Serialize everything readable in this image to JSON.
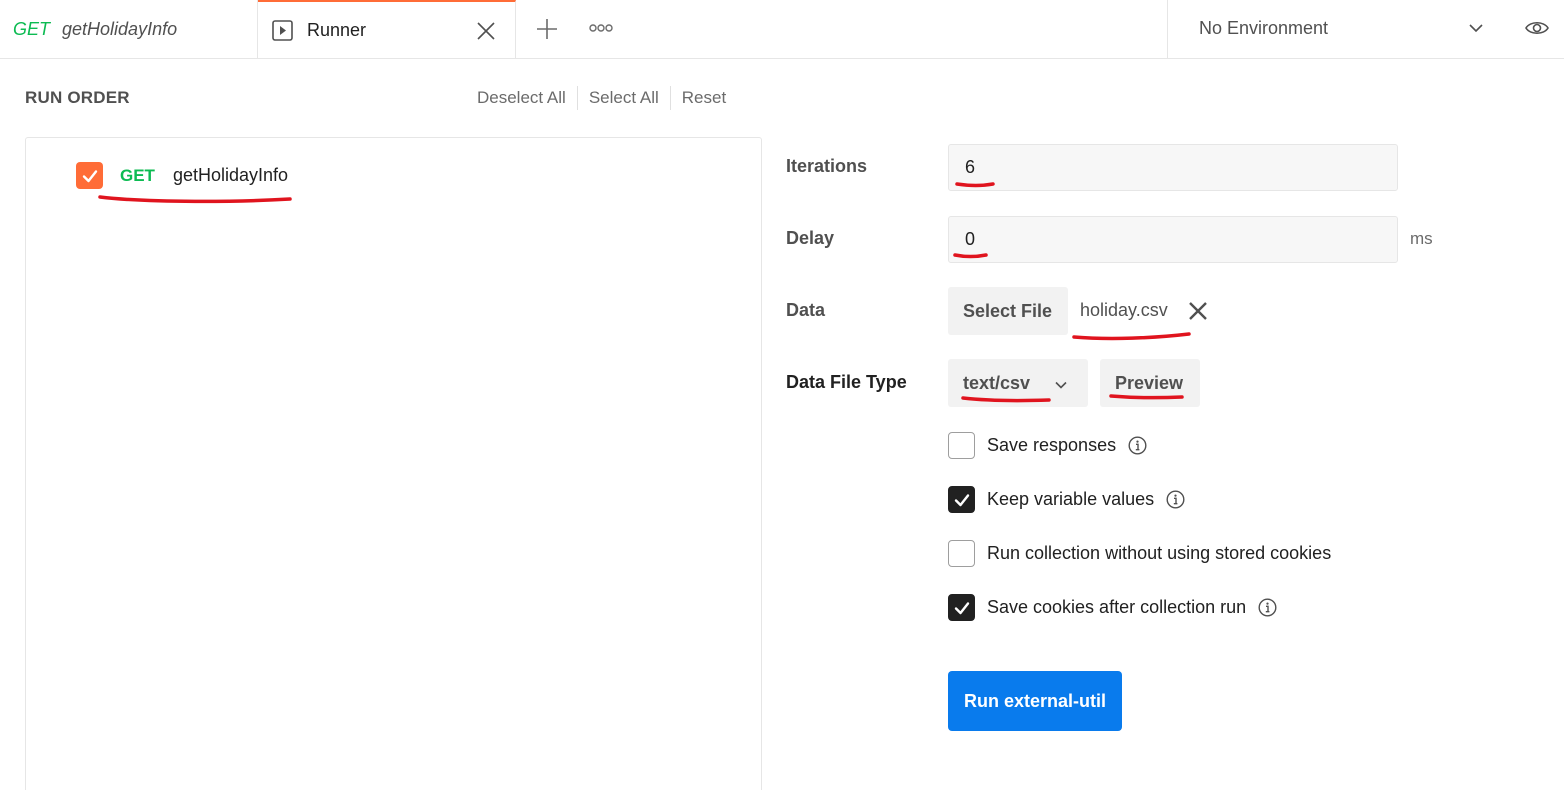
{
  "tabs": [
    {
      "method": "GET",
      "name": "getHolidayInfo"
    },
    {
      "name": "Runner"
    }
  ],
  "environment": {
    "label": "No Environment"
  },
  "run_order": {
    "title": "RUN ORDER",
    "actions": {
      "deselect_all": "Deselect All",
      "select_all": "Select All",
      "reset": "Reset"
    },
    "items": [
      {
        "method": "GET",
        "name": "getHolidayInfo",
        "checked": true
      }
    ]
  },
  "settings": {
    "iterations_label": "Iterations",
    "iterations_value": "6",
    "delay_label": "Delay",
    "delay_value": "0",
    "delay_unit": "ms",
    "data_label": "Data",
    "select_file_label": "Select File",
    "file_name": "holiday.csv",
    "data_file_type_label": "Data File Type",
    "data_file_type_value": "text/csv",
    "preview_label": "Preview",
    "options": [
      {
        "label": "Save responses",
        "checked": false,
        "info": true
      },
      {
        "label": "Keep variable values",
        "checked": true,
        "info": true
      },
      {
        "label": "Run collection without using stored cookies",
        "checked": false,
        "info": false
      },
      {
        "label": "Save cookies after collection run",
        "checked": true,
        "info": true
      }
    ],
    "run_button_label": "Run external-util"
  },
  "colors": {
    "accent": "#ff6c37",
    "method_get": "#0cbb52",
    "primary": "#097bed",
    "annotation": "#e0141e"
  }
}
